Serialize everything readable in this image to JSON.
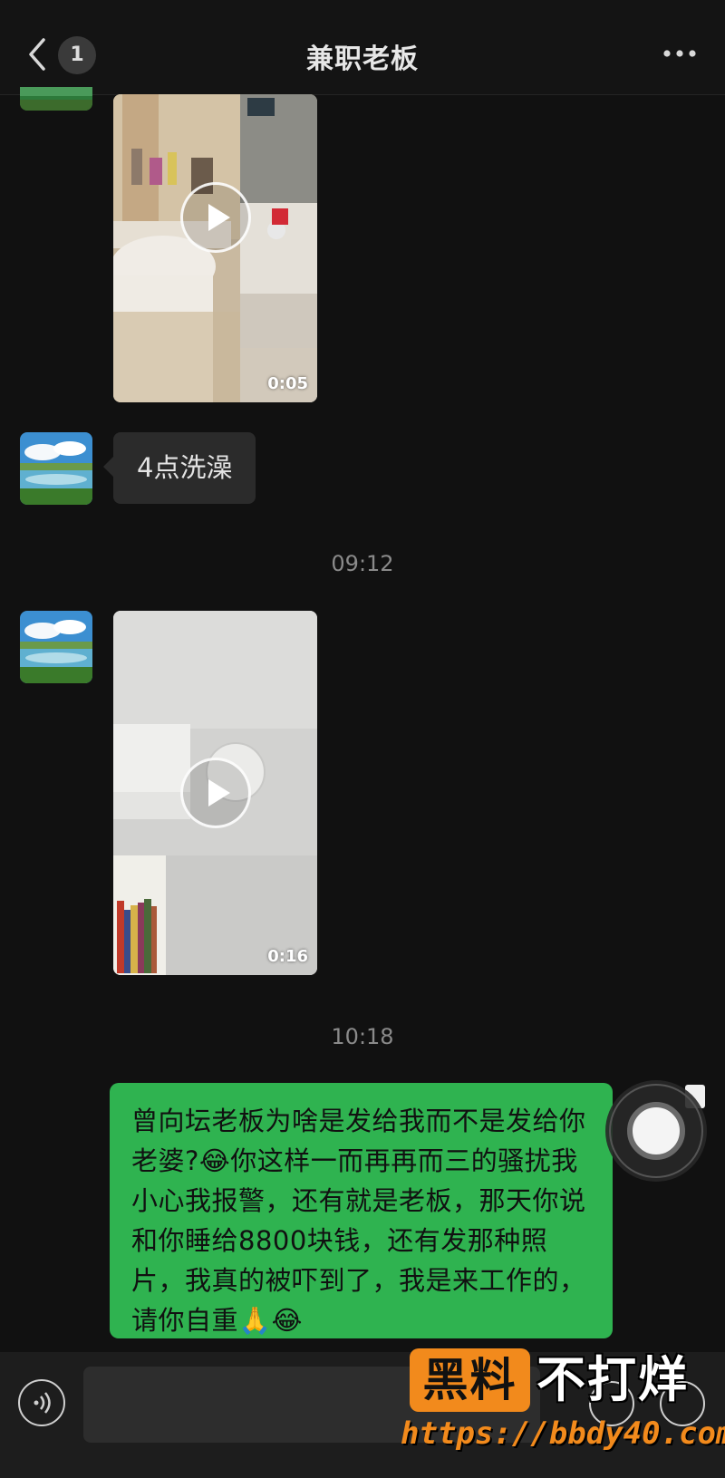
{
  "header": {
    "title": "兼职老板",
    "unread_count": "1"
  },
  "messages": [
    {
      "type": "video",
      "direction": "incoming",
      "duration": "0:05"
    },
    {
      "type": "text",
      "direction": "incoming",
      "text": "4点洗澡"
    },
    {
      "type": "timestamp",
      "text": "09:12"
    },
    {
      "type": "video",
      "direction": "incoming",
      "duration": "0:16"
    },
    {
      "type": "timestamp",
      "text": "10:18"
    },
    {
      "type": "text",
      "direction": "outgoing",
      "text": "曾向坛老板为啥是发给我而不是发给你老婆?😂你这样一而再再而三的骚扰我小心我报警，还有就是老板，那天你说和你睡给8800块钱，还有发那种照片，我真的被吓到了，我是来工作的，请你自重🙏😂"
    }
  ],
  "watermark": {
    "badge": "黑料",
    "text": "不打烊",
    "url": "https://bbdy40.com"
  },
  "colors": {
    "background": "#111111",
    "outgoing_bubble": "#2fb350",
    "incoming_bubble": "#2b2b2b",
    "watermark_accent": "#f28a1c"
  },
  "icons": [
    "back-arrow-icon",
    "more-icon",
    "play-icon",
    "voice-icon",
    "emoji-icon",
    "plus-icon"
  ]
}
